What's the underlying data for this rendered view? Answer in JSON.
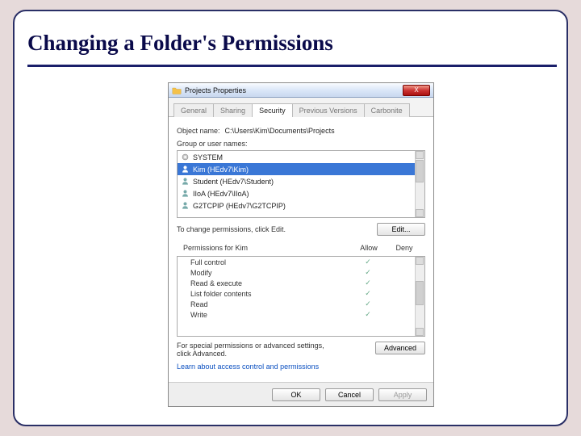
{
  "slide": {
    "title": "Changing a Folder's Permissions"
  },
  "dialog": {
    "title": "Projects Properties",
    "close": "X",
    "tabs": [
      {
        "label": "General",
        "active": false
      },
      {
        "label": "Sharing",
        "active": false
      },
      {
        "label": "Security",
        "active": true
      },
      {
        "label": "Previous Versions",
        "active": false
      },
      {
        "label": "Carbonite",
        "active": false
      }
    ],
    "object_label": "Object name:",
    "object_value": "C:\\Users\\Kim\\Documents\\Projects",
    "group_label": "Group or user names:",
    "users": [
      {
        "name": "SYSTEM",
        "selected": false,
        "icon": "gear"
      },
      {
        "name": "Kim (HEdv7\\Kim)",
        "selected": true,
        "icon": "user"
      },
      {
        "name": "Student (HEdv7\\Student)",
        "selected": false,
        "icon": "user"
      },
      {
        "name": "IIoA (HEdv7\\IIoA)",
        "selected": false,
        "icon": "user"
      },
      {
        "name": "G2TCPIP (HEdv7\\G2TCPIP)",
        "selected": false,
        "icon": "user"
      }
    ],
    "edit_hint": "To change permissions, click Edit.",
    "edit_button": "Edit...",
    "perm_header": "Permissions for Kim",
    "perm_allow": "Allow",
    "perm_deny": "Deny",
    "perms": [
      {
        "name": "Full control",
        "allow": true,
        "deny": false
      },
      {
        "name": "Modify",
        "allow": true,
        "deny": false
      },
      {
        "name": "Read & execute",
        "allow": true,
        "deny": false
      },
      {
        "name": "List folder contents",
        "allow": true,
        "deny": false
      },
      {
        "name": "Read",
        "allow": true,
        "deny": false
      },
      {
        "name": "Write",
        "allow": true,
        "deny": false
      }
    ],
    "advanced_hint": "For special permissions or advanced settings, click Advanced.",
    "advanced_button": "Advanced",
    "learn_link": "Learn about access control and permissions",
    "footer": {
      "ok": "OK",
      "cancel": "Cancel",
      "apply": "Apply"
    }
  }
}
